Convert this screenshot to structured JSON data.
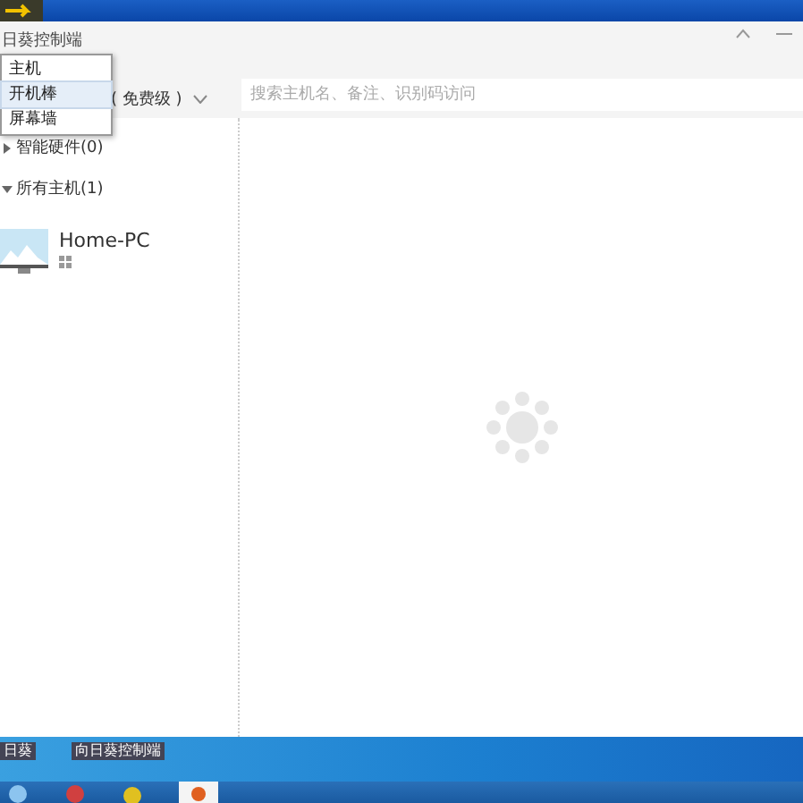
{
  "window": {
    "title": "日葵控制端",
    "edition": "( 免费级 )"
  },
  "menu": [
    {
      "label": "主机",
      "selected": false
    },
    {
      "label": "开机棒",
      "selected": true
    },
    {
      "label": "屏幕墙",
      "selected": false
    }
  ],
  "search": {
    "placeholder": "搜索主机名、备注、识别码访问"
  },
  "groups": [
    {
      "label": "智能硬件(0)",
      "expanded": false
    },
    {
      "label": "所有主机(1)",
      "expanded": true
    }
  ],
  "hosts": [
    {
      "name": "Home-PC"
    }
  ],
  "desktop_icons": [
    {
      "label": "日葵"
    },
    {
      "label": "向日葵控制端"
    }
  ]
}
